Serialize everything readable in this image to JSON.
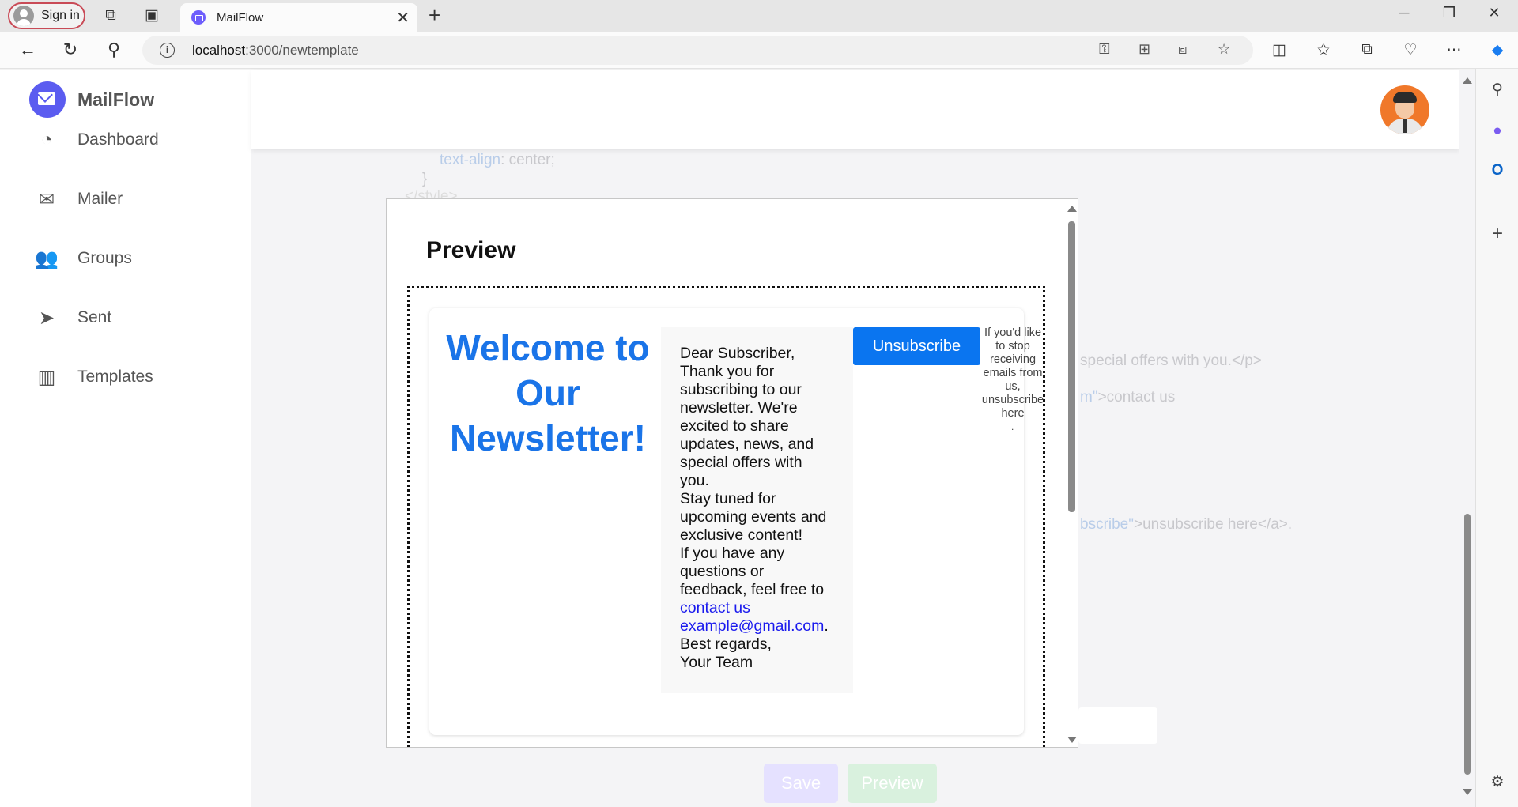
{
  "browser": {
    "signin_label": "Sign in",
    "tab_title": "MailFlow",
    "url_host": "localhost",
    "url_path": ":3000/newtemplate"
  },
  "app": {
    "name": "MailFlow",
    "nav": [
      {
        "label": "Dashboard",
        "icon": "dashboard-gauge-icon"
      },
      {
        "label": "Mailer",
        "icon": "mailer-icon"
      },
      {
        "label": "Groups",
        "icon": "groups-icon"
      },
      {
        "label": "Sent",
        "icon": "paper-plane-icon"
      },
      {
        "label": "Templates",
        "icon": "templates-icon"
      }
    ],
    "colors": {
      "brand": "#5b5cf0",
      "link": "#1a74e8",
      "unsubscribe": "#0a75f0"
    }
  },
  "background_code": {
    "line1_prop": "text-align",
    "line1_value": ": center;",
    "line2": "}",
    "line3": "</style>",
    "offers": "special offers with you.</p>",
    "contact_attr": "m\"",
    "contact_text": ">contact us",
    "unsub_attr": "bscribe\"",
    "unsub_text": ">unsubscribe here</a>."
  },
  "actions": {
    "save_label": "Save",
    "preview_label": "Preview"
  },
  "preview": {
    "title": "Preview",
    "welcome_heading": "Welcome to Our Newsletter!",
    "greeting": "Dear Subscriber,",
    "para1": "Thank you for subscribing to our newsletter. We're excited to share updates, news, and special offers with you.",
    "para2": "Stay tuned for upcoming events and exclusive content!",
    "para3": "If you have any questions or feedback, feel free to",
    "contact_link": "contact us",
    "email_link": "example@gmail.com",
    "email_suffix": ".",
    "closing": "Best regards,",
    "signature": "Your Team",
    "unsubscribe_button": "Unsubscribe",
    "unsubscribe_note": "If you'd like to stop receiving emails from us, unsubscribe here",
    "unsubscribe_dot": "."
  }
}
